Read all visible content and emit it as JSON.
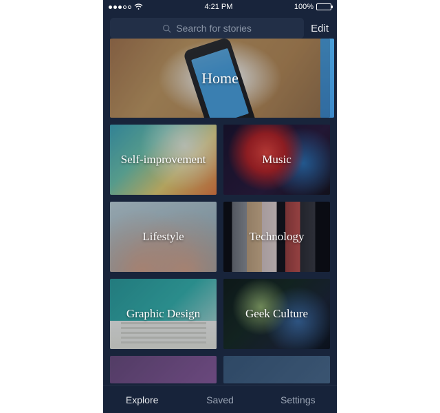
{
  "status": {
    "time": "4:21 PM",
    "battery_pct": "100%"
  },
  "search": {
    "placeholder": "Search for stories",
    "edit_label": "Edit"
  },
  "categories": {
    "home": "Home",
    "self_improvement": "Self-improvement",
    "music": "Music",
    "lifestyle": "Lifestyle",
    "technology": "Technology",
    "graphic_design": "Graphic Design",
    "geek_culture": "Geek Culture"
  },
  "tabs": {
    "explore": "Explore",
    "saved": "Saved",
    "settings": "Settings"
  }
}
